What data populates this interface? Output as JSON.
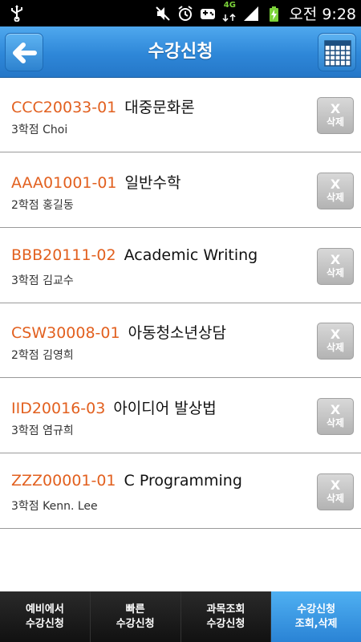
{
  "status_bar": {
    "network": "4G",
    "time": "오전 9:28"
  },
  "header": {
    "title": "수강신청"
  },
  "courses": [
    {
      "code": "CCC20033-01",
      "name": "대중문화론",
      "credits": "3학점",
      "professor": "Choi",
      "delete_x": "X",
      "delete_label": "삭제"
    },
    {
      "code": "AAA01001-01",
      "name": "일반수학",
      "credits": "2학점",
      "professor": "홍길동",
      "delete_x": "X",
      "delete_label": "삭제"
    },
    {
      "code": "BBB20111-02",
      "name": "Academic Writing",
      "credits": "3학점",
      "professor": "김교수",
      "delete_x": "X",
      "delete_label": "삭제"
    },
    {
      "code": "CSW30008-01",
      "name": "아동청소년상담",
      "credits": "2학점",
      "professor": "김영희",
      "delete_x": "X",
      "delete_label": "삭제"
    },
    {
      "code": "IID20016-03",
      "name": "아이디어 발상법",
      "credits": "3학점",
      "professor": "염규희",
      "delete_x": "X",
      "delete_label": "삭제"
    },
    {
      "code": "ZZZ00001-01",
      "name": "C Programming",
      "credits": "3학점",
      "professor": "Kenn. Lee",
      "delete_x": "X",
      "delete_label": "삭제"
    }
  ],
  "tabs": [
    {
      "line1": "예비에서",
      "line2": "수강신청",
      "active": false
    },
    {
      "line1": "빠른",
      "line2": "수강신청",
      "active": false
    },
    {
      "line1": "과목조회",
      "line2": "수강신청",
      "active": false
    },
    {
      "line1": "수강신청",
      "line2": "조회,삭제",
      "active": true
    }
  ],
  "colors": {
    "accent": "#2e87d8",
    "course_code": "#e2601f",
    "tab_bar": "#1a1a1a"
  },
  "icons": [
    "usb-icon",
    "mute-icon",
    "alarm-icon",
    "game-icon",
    "4g-data-icon",
    "signal-icon",
    "battery-icon",
    "back-arrow-icon",
    "calendar-icon",
    "cloud-decoration"
  ]
}
